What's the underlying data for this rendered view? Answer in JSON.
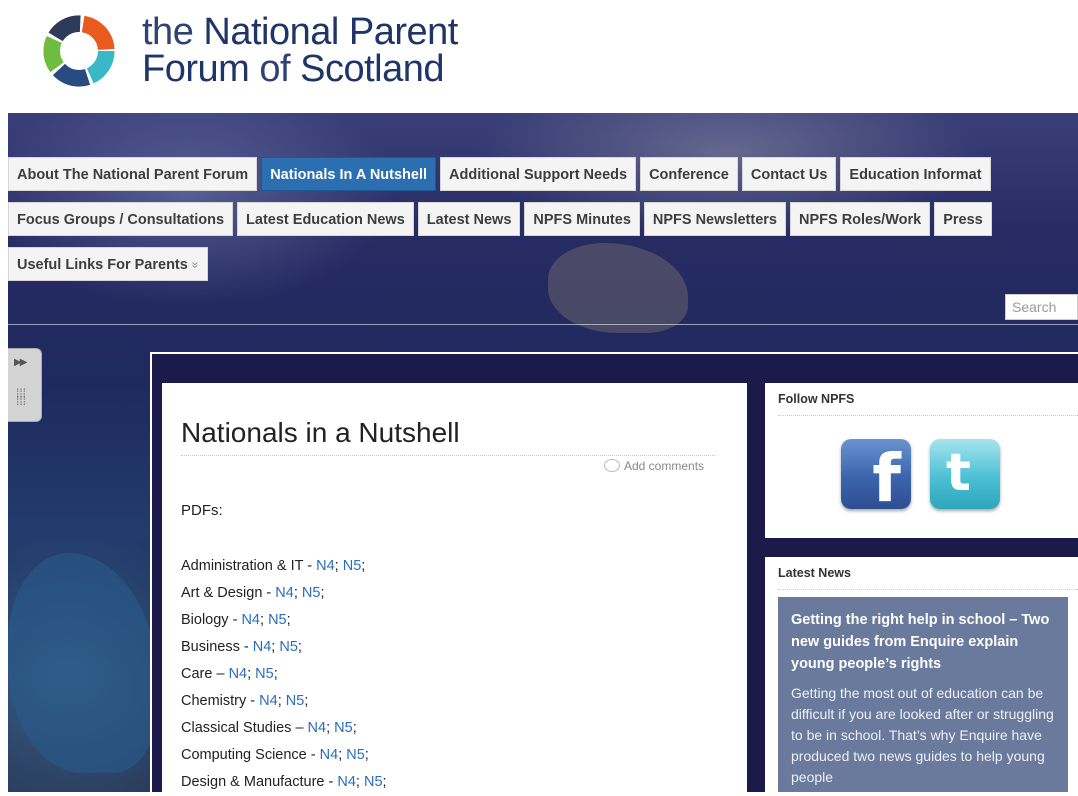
{
  "logo": {
    "line1_thin": "the",
    "line1_bold": "National Parent",
    "line2_bold_a": "Forum",
    "line2_thin": "of",
    "line2_bold_b": "Scotland"
  },
  "nav": {
    "row1": [
      {
        "label": "About The National Parent Forum",
        "active": false
      },
      {
        "label": "Nationals In A Nutshell",
        "active": true
      },
      {
        "label": "Additional Support Needs",
        "active": false
      },
      {
        "label": "Conference",
        "active": false
      },
      {
        "label": "Contact Us",
        "active": false
      },
      {
        "label": "Education Informat",
        "active": false
      }
    ],
    "row2": [
      {
        "label": "Focus Groups / Consultations"
      },
      {
        "label": "Latest Education News"
      },
      {
        "label": "Latest News"
      },
      {
        "label": "NPFS Minutes"
      },
      {
        "label": "NPFS Newsletters"
      },
      {
        "label": "NPFS Roles/Work"
      },
      {
        "label": "Press"
      }
    ],
    "row3": [
      {
        "label": "Useful Links For Parents",
        "chevron": "»"
      }
    ]
  },
  "search": {
    "placeholder": "Search"
  },
  "article": {
    "title": "Nationals in a Nutshell",
    "comments": "Add comments",
    "pdfs_label": "PDFs:",
    "subjects": [
      {
        "name": "Administration & IT",
        "sep": " - "
      },
      {
        "name": "Art & Design",
        "sep": " - "
      },
      {
        "name": "Biology",
        "sep": " - "
      },
      {
        "name": "Business",
        "sep": " - "
      },
      {
        "name": "Care",
        "sep": " – "
      },
      {
        "name": "Chemistry",
        "sep": " - "
      },
      {
        "name": "Classical Studies",
        "sep": " – "
      },
      {
        "name": "Computing Science",
        "sep": " - "
      },
      {
        "name": "Design & Manufacture",
        "sep": " - "
      }
    ],
    "link_n4": "N4",
    "link_n5": "N5"
  },
  "sidebar": {
    "follow": {
      "heading": "Follow NPFS",
      "facebook_glyph": "f",
      "twitter_glyph": "t"
    },
    "news": {
      "heading": "Latest News",
      "headline": "Getting the right help in school – Two new guides from Enquire explain young people’s rights",
      "body": "Getting the most out of education can be difficult if you are looked after or struggling to be in school. That’s why Enquire have produced two news guides to help young people"
    }
  },
  "colors": {
    "accent": "#2c6fb0",
    "link": "#2a6db8",
    "news_box": "#6a7a9c",
    "frame": "#1c1a4a"
  }
}
